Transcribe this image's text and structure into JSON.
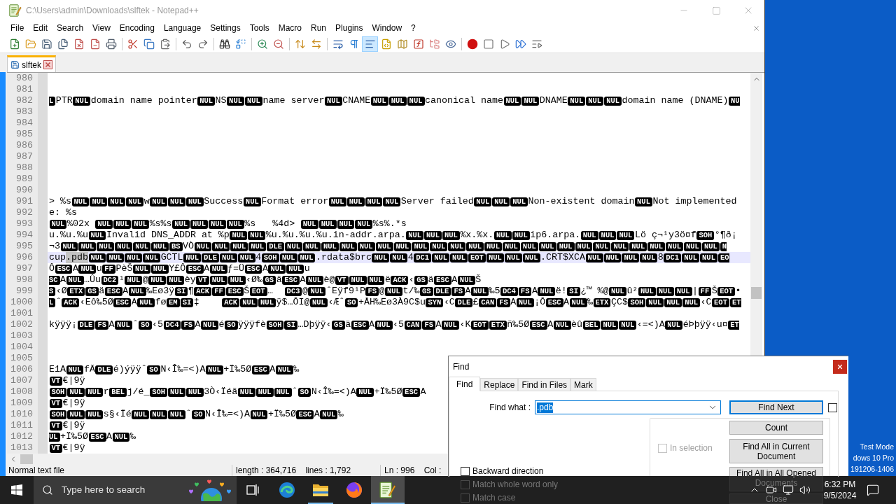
{
  "window": {
    "title": "C:\\Users\\admin\\Downloads\\slftek - Notepad++",
    "active": false
  },
  "menu": [
    "File",
    "Edit",
    "Search",
    "View",
    "Encoding",
    "Language",
    "Settings",
    "Tools",
    "Macro",
    "Run",
    "Plugins",
    "Window",
    "?"
  ],
  "toolbar": [
    [
      {
        "pressed": false
      },
      {
        "pressed": false
      },
      {
        "pressed": false
      },
      {
        "pressed": false
      },
      {
        "pressed": false
      },
      {
        "pressed": false
      },
      {
        "pressed": false
      }
    ],
    [
      {
        "pressed": false
      },
      {
        "pressed": false
      },
      {
        "pressed": false
      }
    ],
    [
      {
        "pressed": false
      },
      {
        "pressed": false
      }
    ],
    [
      {
        "pressed": false
      },
      {
        "pressed": false
      }
    ],
    [
      {
        "pressed": false
      },
      {
        "pressed": false
      }
    ],
    [
      {
        "pressed": false
      },
      {
        "pressed": false
      }
    ],
    [
      {
        "pressed": false
      },
      {
        "pressed": false
      },
      {
        "pressed": true
      },
      {
        "pressed": false
      },
      {
        "pressed": false
      },
      {
        "pressed": false
      },
      {
        "pressed": false
      },
      {
        "pressed": false
      }
    ],
    [
      {
        "pressed": false
      },
      {
        "pressed": false
      },
      {
        "pressed": false
      },
      {
        "pressed": false
      },
      {
        "pressed": false
      }
    ]
  ],
  "tabs": [
    {
      "label": "slftek",
      "selected": true,
      "modified": false
    }
  ],
  "editor": {
    "lines": [
      {
        "number": "980",
        "current": false
      },
      {
        "number": "981",
        "current": false
      },
      {
        "number": "982",
        "current": false,
        "segments": [
          {
            "kind": "ctrl_cut_left",
            "text": "L"
          },
          {
            "kind": "text",
            "text": "PTR"
          },
          {
            "kind": "ctrl",
            "text": "NUL"
          },
          {
            "kind": "text",
            "text": "domain name pointer"
          },
          {
            "kind": "ctrl",
            "text": "NUL"
          },
          {
            "kind": "text",
            "text": "NS"
          },
          {
            "kind": "ctrl",
            "text": "NUL"
          },
          {
            "kind": "ctrl",
            "text": "NUL"
          },
          {
            "kind": "text",
            "text": "name server"
          },
          {
            "kind": "ctrl",
            "text": "NUL"
          },
          {
            "kind": "text",
            "text": "CNAME"
          },
          {
            "kind": "ctrl",
            "text": "NUL"
          },
          {
            "kind": "ctrl",
            "text": "NUL"
          },
          {
            "kind": "ctrl",
            "text": "NUL"
          },
          {
            "kind": "text",
            "text": "canonical name"
          },
          {
            "kind": "ctrl",
            "text": "NUL"
          },
          {
            "kind": "ctrl",
            "text": "NUL"
          },
          {
            "kind": "text",
            "text": "DNAME"
          },
          {
            "kind": "ctrl",
            "text": "NUL"
          },
          {
            "kind": "ctrl",
            "text": "NUL"
          },
          {
            "kind": "ctrl",
            "text": "NUL"
          },
          {
            "kind": "text",
            "text": "domain name (DNAME)"
          },
          {
            "kind": "ctrl_cut_right",
            "text": "NU"
          }
        ]
      },
      {
        "number": "983",
        "current": false
      },
      {
        "number": "984",
        "current": false
      },
      {
        "number": "985",
        "current": false
      },
      {
        "number": "986",
        "current": false
      },
      {
        "number": "987",
        "current": false
      },
      {
        "number": "988",
        "current": false
      },
      {
        "number": "989",
        "current": false
      },
      {
        "number": "990",
        "current": false
      },
      {
        "number": "991",
        "current": false,
        "segments": [
          {
            "kind": "text",
            "text": "> %s"
          },
          {
            "kind": "ctrl",
            "text": "NUL"
          },
          {
            "kind": "ctrl",
            "text": "NUL"
          },
          {
            "kind": "ctrl",
            "text": "NUL"
          },
          {
            "kind": "ctrl",
            "text": "NUL"
          },
          {
            "kind": "text",
            "text": "w"
          },
          {
            "kind": "ctrl",
            "text": "NUL"
          },
          {
            "kind": "ctrl",
            "text": "NUL"
          },
          {
            "kind": "ctrl",
            "text": "NUL"
          },
          {
            "kind": "text",
            "text": "Success"
          },
          {
            "kind": "ctrl",
            "text": "NUL"
          },
          {
            "kind": "text",
            "text": "Format error"
          },
          {
            "kind": "ctrl",
            "text": "NUL"
          },
          {
            "kind": "ctrl",
            "text": "NUL"
          },
          {
            "kind": "ctrl",
            "text": "NUL"
          },
          {
            "kind": "ctrl",
            "text": "NUL"
          },
          {
            "kind": "text",
            "text": "Server failed"
          },
          {
            "kind": "ctrl",
            "text": "NUL"
          },
          {
            "kind": "ctrl",
            "text": "NUL"
          },
          {
            "kind": "ctrl",
            "text": "NUL"
          },
          {
            "kind": "text",
            "text": "Non-existent domain"
          },
          {
            "kind": "ctrl",
            "text": "NUL"
          },
          {
            "kind": "text",
            "text": "Not implemented"
          }
        ]
      },
      {
        "number": "992",
        "current": false,
        "segments": [
          {
            "kind": "text",
            "text": "e: %s"
          }
        ]
      },
      {
        "number": "993",
        "current": false,
        "segments": [
          {
            "kind": "ctrl",
            "text": "NUL"
          },
          {
            "kind": "text",
            "text": "%02x "
          },
          {
            "kind": "ctrl",
            "text": "NUL"
          },
          {
            "kind": "ctrl",
            "text": "NUL"
          },
          {
            "kind": "ctrl",
            "text": "NUL"
          },
          {
            "kind": "text",
            "text": "%s%s"
          },
          {
            "kind": "ctrl",
            "text": "NUL"
          },
          {
            "kind": "ctrl",
            "text": "NUL"
          },
          {
            "kind": "ctrl",
            "text": "NUL"
          },
          {
            "kind": "ctrl",
            "text": "NUL"
          },
          {
            "kind": "text",
            "text": "%s   %4d> "
          },
          {
            "kind": "ctrl",
            "text": "NUL"
          },
          {
            "kind": "ctrl",
            "text": "NUL"
          },
          {
            "kind": "ctrl",
            "text": "NUL"
          },
          {
            "kind": "ctrl",
            "text": "NUL"
          },
          {
            "kind": "text",
            "text": "%s%.*s"
          }
        ]
      },
      {
        "number": "994",
        "current": false,
        "segments": [
          {
            "kind": "text",
            "text": "u.%u.%u"
          },
          {
            "kind": "ctrl",
            "text": "NUL"
          },
          {
            "kind": "text",
            "text": "Invalid DNS_ADDR at %p"
          },
          {
            "kind": "ctrl",
            "text": "NUL"
          },
          {
            "kind": "ctrl",
            "text": "NUL"
          },
          {
            "kind": "text",
            "text": "%u.%u.%u.%u.in-addr.arpa."
          },
          {
            "kind": "ctrl",
            "text": "NUL"
          },
          {
            "kind": "ctrl",
            "text": "NUL"
          },
          {
            "kind": "ctrl",
            "text": "NUL"
          },
          {
            "kind": "text",
            "text": "%x.%x."
          },
          {
            "kind": "ctrl",
            "text": "NUL"
          },
          {
            "kind": "ctrl",
            "text": "NUL"
          },
          {
            "kind": "text",
            "text": "ip6.arpa."
          },
          {
            "kind": "ctrl",
            "text": "NUL"
          },
          {
            "kind": "ctrl",
            "text": "NUL"
          },
          {
            "kind": "ctrl",
            "text": "NUL"
          },
          {
            "kind": "text",
            "text": "Lö ç¬¹y3ö¤f"
          },
          {
            "kind": "ctrl",
            "text": "SOH"
          },
          {
            "kind": "text",
            "text": "°¶ð¡"
          }
        ]
      },
      {
        "number": "995",
        "current": false,
        "segments": [
          {
            "kind": "text",
            "text": "¬3"
          },
          {
            "kind": "ctrl",
            "text": "NUL"
          },
          {
            "kind": "ctrl",
            "text": "NUL"
          },
          {
            "kind": "ctrl",
            "text": "NUL"
          },
          {
            "kind": "ctrl",
            "text": "NUL"
          },
          {
            "kind": "ctrl",
            "text": "NUL"
          },
          {
            "kind": "ctrl",
            "text": "NUL"
          },
          {
            "kind": "ctrl",
            "text": "BS"
          },
          {
            "kind": "text",
            "text": "VÒ"
          },
          {
            "kind": "ctrl",
            "text": "NUL"
          },
          {
            "kind": "ctrl",
            "text": "NUL"
          },
          {
            "kind": "ctrl",
            "text": "NUL"
          },
          {
            "kind": "ctrl",
            "text": "NUL"
          },
          {
            "kind": "ctrl",
            "text": "DLE"
          },
          {
            "kind": "ctrl",
            "text": "NUL"
          },
          {
            "kind": "ctrl",
            "text": "NUL"
          },
          {
            "kind": "ctrl",
            "text": "NUL"
          },
          {
            "kind": "ctrl",
            "text": "NUL"
          },
          {
            "kind": "ctrl",
            "text": "NUL"
          },
          {
            "kind": "ctrl",
            "text": "NUL"
          },
          {
            "kind": "ctrl",
            "text": "NUL"
          },
          {
            "kind": "ctrl",
            "text": "NUL"
          },
          {
            "kind": "ctrl",
            "text": "NUL"
          },
          {
            "kind": "ctrl",
            "text": "NUL"
          },
          {
            "kind": "ctrl",
            "text": "NUL"
          },
          {
            "kind": "ctrl",
            "text": "NUL"
          },
          {
            "kind": "ctrl",
            "text": "NUL"
          },
          {
            "kind": "ctrl",
            "text": "NUL"
          },
          {
            "kind": "ctrl",
            "text": "NUL"
          },
          {
            "kind": "ctrl",
            "text": "NUL"
          },
          {
            "kind": "ctrl",
            "text": "NUL"
          },
          {
            "kind": "ctrl",
            "text": "NUL"
          },
          {
            "kind": "ctrl",
            "text": "NUL"
          },
          {
            "kind": "ctrl",
            "text": "NUL"
          },
          {
            "kind": "ctrl",
            "text": "NUL"
          },
          {
            "kind": "ctrl",
            "text": "NUL"
          },
          {
            "kind": "ctrl",
            "text": "NUL"
          },
          {
            "kind": "ctrl",
            "text": "NUL"
          },
          {
            "kind": "ctrl_cut_right",
            "text": "N"
          }
        ]
      },
      {
        "number": "996",
        "current": true,
        "segments": [
          {
            "kind": "text",
            "text": "cup"
          },
          {
            "kind": "selection",
            "text": ".pdb"
          },
          {
            "kind": "ctrl",
            "text": "NUL"
          },
          {
            "kind": "ctrl",
            "text": "NUL"
          },
          {
            "kind": "ctrl",
            "text": "NUL"
          },
          {
            "kind": "ctrl",
            "text": "NUL"
          },
          {
            "kind": "text",
            "text": "GCTL"
          },
          {
            "kind": "ctrl",
            "text": "NUL"
          },
          {
            "kind": "ctrl",
            "text": "DLE"
          },
          {
            "kind": "ctrl",
            "text": "NUL"
          },
          {
            "kind": "ctrl",
            "text": "NUL"
          },
          {
            "kind": "text",
            "text": "4"
          },
          {
            "kind": "ctrl",
            "text": "SOH"
          },
          {
            "kind": "ctrl",
            "text": "NUL"
          },
          {
            "kind": "ctrl",
            "text": "NUL"
          },
          {
            "kind": "text",
            "text": ".rdata$brc"
          },
          {
            "kind": "ctrl",
            "text": "NUL"
          },
          {
            "kind": "ctrl",
            "text": "NUL"
          },
          {
            "kind": "text",
            "text": "4"
          },
          {
            "kind": "ctrl",
            "text": "DC1"
          },
          {
            "kind": "ctrl",
            "text": "NUL"
          },
          {
            "kind": "ctrl",
            "text": "NUL"
          },
          {
            "kind": "ctrl",
            "text": "EOT"
          },
          {
            "kind": "ctrl",
            "text": "NUL"
          },
          {
            "kind": "ctrl",
            "text": "NUL"
          },
          {
            "kind": "ctrl",
            "text": "NUL"
          },
          {
            "kind": "text",
            "text": ".CRT$XCA"
          },
          {
            "kind": "ctrl",
            "text": "NUL"
          },
          {
            "kind": "ctrl",
            "text": "NUL"
          },
          {
            "kind": "ctrl",
            "text": "NUL"
          },
          {
            "kind": "ctrl",
            "text": "NUL"
          },
          {
            "kind": "text",
            "text": "8"
          },
          {
            "kind": "ctrl",
            "text": "DC1"
          },
          {
            "kind": "ctrl",
            "text": "NUL"
          },
          {
            "kind": "ctrl",
            "text": "NUL"
          },
          {
            "kind": "ctrl_cut_right",
            "text": "EO"
          }
        ]
      },
      {
        "number": "997",
        "current": false,
        "segments": [
          {
            "kind": "text",
            "text": "Ô"
          },
          {
            "kind": "ctrl",
            "text": "ESC"
          },
          {
            "kind": "text",
            "text": "A"
          },
          {
            "kind": "ctrl",
            "text": "NUL"
          },
          {
            "kind": "text",
            "text": "u"
          },
          {
            "kind": "ctrl",
            "text": "FF"
          },
          {
            "kind": "text",
            "text": "PèŠ"
          },
          {
            "kind": "ctrl",
            "text": "NUL"
          },
          {
            "kind": "ctrl",
            "text": "NUL"
          },
          {
            "kind": "text",
            "text": "Y£Ô"
          },
          {
            "kind": "ctrl",
            "text": "ESC"
          },
          {
            "kind": "text",
            "text": "A"
          },
          {
            "kind": "ctrl",
            "text": "NUL"
          },
          {
            "kind": "text",
            "text": "ƒ=Ü"
          },
          {
            "kind": "ctrl",
            "text": "ESC"
          },
          {
            "kind": "text",
            "text": "A"
          },
          {
            "kind": "ctrl",
            "text": "NUL"
          },
          {
            "kind": "ctrl",
            "text": "NUL"
          },
          {
            "kind": "text",
            "text": "u"
          }
        ]
      },
      {
        "number": "998",
        "current": false,
        "segments": [
          {
            "kind": "ctrl_cut_left",
            "text": "SC"
          },
          {
            "kind": "text",
            "text": "A"
          },
          {
            "kind": "ctrl",
            "text": "NUL"
          },
          {
            "kind": "text",
            "text": "…Ûu"
          },
          {
            "kind": "ctrl",
            "text": "DC2"
          },
          {
            "kind": "text",
            "text": "¹"
          },
          {
            "kind": "ctrl",
            "text": "NUL"
          },
          {
            "kind": "text",
            "text": "@"
          },
          {
            "kind": "ctrl",
            "text": "NUL"
          },
          {
            "kind": "ctrl",
            "text": "NUL"
          },
          {
            "kind": "text",
            "text": "èy"
          },
          {
            "kind": "ctrl",
            "text": "VT"
          },
          {
            "kind": "ctrl",
            "text": "NUL"
          },
          {
            "kind": "ctrl",
            "text": "NUL"
          },
          {
            "kind": "text",
            "text": "‹Ø‰"
          },
          {
            "kind": "ctrl",
            "text": "GS"
          },
          {
            "kind": "text",
            "text": "ä"
          },
          {
            "kind": "ctrl",
            "text": "ESC"
          },
          {
            "kind": "text",
            "text": "A"
          },
          {
            "kind": "ctrl",
            "text": "NUL"
          },
          {
            "kind": "text",
            "text": "è@"
          },
          {
            "kind": "ctrl",
            "text": "VT"
          },
          {
            "kind": "ctrl",
            "text": "NUL"
          },
          {
            "kind": "ctrl",
            "text": "NUL"
          },
          {
            "kind": "text",
            "text": "ë"
          },
          {
            "kind": "ctrl",
            "text": "ACK"
          },
          {
            "kind": "text",
            "text": "‹"
          },
          {
            "kind": "ctrl",
            "text": "GS"
          },
          {
            "kind": "text",
            "text": "ä"
          },
          {
            "kind": "ctrl",
            "text": "ESC"
          },
          {
            "kind": "text",
            "text": "A"
          },
          {
            "kind": "ctrl",
            "text": "NUL"
          },
          {
            "kind": "text",
            "text": "Š"
          }
        ]
      },
      {
        "number": "999",
        "current": false,
        "segments": [
          {
            "kind": "ctrl_cut_left",
            "text": "S"
          },
          {
            "kind": "text",
            "text": "‹Ø"
          },
          {
            "kind": "ctrl",
            "text": "ETX"
          },
          {
            "kind": "ctrl",
            "text": "GS"
          },
          {
            "kind": "text",
            "text": "ä"
          },
          {
            "kind": "ctrl",
            "text": "ESC"
          },
          {
            "kind": "text",
            "text": "A"
          },
          {
            "kind": "ctrl",
            "text": "NUL"
          },
          {
            "kind": "text",
            "text": "‰Eø3ÿ"
          },
          {
            "kind": "ctrl",
            "text": "SI"
          },
          {
            "kind": "text",
            "text": "¶"
          },
          {
            "kind": "ctrl",
            "text": "ACK"
          },
          {
            "kind": "ctrl",
            "text": "FF"
          },
          {
            "kind": "ctrl",
            "text": "ESC"
          },
          {
            "kind": "text",
            "text": "Š"
          },
          {
            "kind": "ctrl",
            "text": "EOT"
          },
          {
            "kind": "text",
            "text": "…  "
          },
          {
            "kind": "ctrl",
            "text": "DC3"
          },
          {
            "kind": "text",
            "text": "@"
          },
          {
            "kind": "ctrl",
            "text": "NUL"
          },
          {
            "kind": "text",
            "text": "ˆEÿf9¹P"
          },
          {
            "kind": "ctrl",
            "text": "FS"
          },
          {
            "kind": "text",
            "text": "@"
          },
          {
            "kind": "ctrl",
            "text": "NUL"
          },
          {
            "kind": "text",
            "text": "t/‰"
          },
          {
            "kind": "ctrl",
            "text": "GS"
          },
          {
            "kind": "ctrl",
            "text": "DLE"
          },
          {
            "kind": "ctrl",
            "text": "FS"
          },
          {
            "kind": "text",
            "text": "A"
          },
          {
            "kind": "ctrl",
            "text": "NUL"
          },
          {
            "kind": "text",
            "text": "‰5"
          },
          {
            "kind": "ctrl",
            "text": "DC4"
          },
          {
            "kind": "ctrl",
            "text": "FS"
          },
          {
            "kind": "text",
            "text": "A"
          },
          {
            "kind": "ctrl",
            "text": "NUL"
          },
          {
            "kind": "text",
            "text": "ë!"
          },
          {
            "kind": "ctrl",
            "text": "SI"
          },
          {
            "kind": "text",
            "text": "¿™ %@"
          },
          {
            "kind": "ctrl",
            "text": "NUL"
          },
          {
            "kind": "text",
            "text": "û²"
          },
          {
            "kind": "ctrl",
            "text": "NUL"
          },
          {
            "kind": "ctrl",
            "text": "NUL"
          },
          {
            "kind": "ctrl",
            "text": "NUL"
          },
          {
            "kind": "text",
            "text": "|"
          },
          {
            "kind": "ctrl",
            "text": "FF"
          },
          {
            "kind": "text",
            "text": "Š"
          },
          {
            "kind": "ctrl",
            "text": "EOT"
          },
          {
            "kind": "text",
            "text": "•"
          }
        ]
      },
      {
        "number": "1000",
        "current": false,
        "segments": [
          {
            "kind": "ctrl_cut_left",
            "text": "L"
          },
          {
            "kind": "text",
            "text": "ˆ"
          },
          {
            "kind": "ctrl",
            "text": "ACK"
          },
          {
            "kind": "text",
            "text": "‹Eô‰5Ø"
          },
          {
            "kind": "ctrl",
            "text": "ESC"
          },
          {
            "kind": "text",
            "text": "A"
          },
          {
            "kind": "ctrl",
            "text": "NUL"
          },
          {
            "kind": "text",
            "text": "fø"
          },
          {
            "kind": "ctrl",
            "text": "EM"
          },
          {
            "kind": "ctrl",
            "text": "SI"
          },
          {
            "kind": "text",
            "text": "‡    "
          },
          {
            "kind": "ctrl",
            "text": "ACK"
          },
          {
            "kind": "ctrl",
            "text": "NUL"
          },
          {
            "kind": "ctrl",
            "text": "NUL"
          },
          {
            "kind": "text",
            "text": "ÿ$…ÔI@"
          },
          {
            "kind": "ctrl",
            "text": "NUL"
          },
          {
            "kind": "text",
            "text": "‹Æˆ"
          },
          {
            "kind": "ctrl",
            "text": "SO"
          },
          {
            "kind": "text",
            "text": "+ÅH‰Eø3À9C$u"
          },
          {
            "kind": "ctrl",
            "text": "SYN"
          },
          {
            "kind": "text",
            "text": "‹C"
          },
          {
            "kind": "ctrl",
            "text": "DLE"
          },
          {
            "kind": "text",
            "text": "£"
          },
          {
            "kind": "ctrl",
            "text": "CAN"
          },
          {
            "kind": "ctrl",
            "text": "FS"
          },
          {
            "kind": "text",
            "text": "A"
          },
          {
            "kind": "ctrl",
            "text": "NUL"
          },
          {
            "kind": "text",
            "text": "¡Ô"
          },
          {
            "kind": "ctrl",
            "text": "ESC"
          },
          {
            "kind": "text",
            "text": "A"
          },
          {
            "kind": "ctrl",
            "text": "NUL"
          },
          {
            "kind": "text",
            "text": "‰"
          },
          {
            "kind": "ctrl",
            "text": "ETX"
          },
          {
            "kind": "text",
            "text": "ÇC$"
          },
          {
            "kind": "ctrl",
            "text": "SOH"
          },
          {
            "kind": "ctrl",
            "text": "NUL"
          },
          {
            "kind": "ctrl",
            "text": "NUL"
          },
          {
            "kind": "ctrl",
            "text": "NUL"
          },
          {
            "kind": "text",
            "text": "‹C"
          },
          {
            "kind": "ctrl",
            "text": "EOT"
          },
          {
            "kind": "ctrl_cut_right",
            "text": "ET"
          }
        ]
      },
      {
        "number": "1001",
        "current": false
      },
      {
        "number": "1002",
        "current": false,
        "segments": [
          {
            "kind": "text",
            "text": "kÿÿÿ¡"
          },
          {
            "kind": "ctrl",
            "text": "DLE"
          },
          {
            "kind": "ctrl",
            "text": "FS"
          },
          {
            "kind": "text",
            "text": "A"
          },
          {
            "kind": "ctrl",
            "text": "NUL"
          },
          {
            "kind": "text",
            "text": "ˆ"
          },
          {
            "kind": "ctrl",
            "text": "SO"
          },
          {
            "kind": "text",
            "text": "‹5"
          },
          {
            "kind": "ctrl",
            "text": "DC4"
          },
          {
            "kind": "ctrl",
            "text": "FS"
          },
          {
            "kind": "text",
            "text": "A"
          },
          {
            "kind": "ctrl",
            "text": "NUL"
          },
          {
            "kind": "text",
            "text": "é"
          },
          {
            "kind": "ctrl",
            "text": "SO"
          },
          {
            "kind": "text",
            "text": "ÿÿÿfè"
          },
          {
            "kind": "ctrl",
            "text": "SOH"
          },
          {
            "kind": "ctrl",
            "text": "SI"
          },
          {
            "kind": "text",
            "text": "…Dþÿÿ‹"
          },
          {
            "kind": "ctrl",
            "text": "GS"
          },
          {
            "kind": "text",
            "text": "ä"
          },
          {
            "kind": "ctrl",
            "text": "ESC"
          },
          {
            "kind": "text",
            "text": "A"
          },
          {
            "kind": "ctrl",
            "text": "NUL"
          },
          {
            "kind": "text",
            "text": "‹5"
          },
          {
            "kind": "ctrl",
            "text": "CAN"
          },
          {
            "kind": "ctrl",
            "text": "FS"
          },
          {
            "kind": "text",
            "text": "A"
          },
          {
            "kind": "ctrl",
            "text": "NUL"
          },
          {
            "kind": "text",
            "text": "‹K"
          },
          {
            "kind": "ctrl",
            "text": "EOT"
          },
          {
            "kind": "ctrl",
            "text": "ETX"
          },
          {
            "kind": "text",
            "text": "ñ‰5Ø"
          },
          {
            "kind": "ctrl",
            "text": "ESC"
          },
          {
            "kind": "text",
            "text": "A"
          },
          {
            "kind": "ctrl",
            "text": "NUL"
          },
          {
            "kind": "text",
            "text": "èû"
          },
          {
            "kind": "ctrl",
            "text": "BEL"
          },
          {
            "kind": "ctrl",
            "text": "NUL"
          },
          {
            "kind": "ctrl",
            "text": "NUL"
          },
          {
            "kind": "text",
            "text": "‹=<)A"
          },
          {
            "kind": "ctrl",
            "text": "NUL"
          },
          {
            "kind": "text",
            "text": "éÞþÿÿ‹u¤"
          },
          {
            "kind": "ctrl_cut_right",
            "text": "ET"
          }
        ]
      },
      {
        "number": "1003",
        "current": false
      },
      {
        "number": "1004",
        "current": false
      },
      {
        "number": "1005",
        "current": false
      },
      {
        "number": "1006",
        "current": false,
        "segments": [
          {
            "kind": "text",
            "text": "E1A"
          },
          {
            "kind": "ctrl",
            "text": "NUL"
          },
          {
            "kind": "text",
            "text": "fÄ"
          },
          {
            "kind": "ctrl",
            "text": "DLE"
          },
          {
            "kind": "text",
            "text": "é)ýÿÿˆ"
          },
          {
            "kind": "ctrl",
            "text": "SO"
          },
          {
            "kind": "text",
            "text": "N‹Î‰=<)A"
          },
          {
            "kind": "ctrl",
            "text": "NUL"
          },
          {
            "kind": "text",
            "text": "+Ï‰5Ø"
          },
          {
            "kind": "ctrl",
            "text": "ESC"
          },
          {
            "kind": "text",
            "text": "A"
          },
          {
            "kind": "ctrl",
            "text": "NUL"
          },
          {
            "kind": "text",
            "text": "‰"
          }
        ]
      },
      {
        "number": "1007",
        "current": false,
        "segments": [
          {
            "kind": "ctrl",
            "text": "VT"
          },
          {
            "kind": "text",
            "text": "€|9ÿ"
          }
        ]
      },
      {
        "number": "1008",
        "current": false,
        "segments": [
          {
            "kind": "ctrl",
            "text": "SOH"
          },
          {
            "kind": "ctrl",
            "text": "NUL"
          },
          {
            "kind": "ctrl",
            "text": "NUL"
          },
          {
            "kind": "text",
            "text": "r"
          },
          {
            "kind": "ctrl",
            "text": "BEL"
          },
          {
            "kind": "text",
            "text": "j/é_"
          },
          {
            "kind": "ctrl",
            "text": "SOH"
          },
          {
            "kind": "ctrl",
            "text": "NUL"
          },
          {
            "kind": "ctrl",
            "text": "NUL"
          },
          {
            "kind": "text",
            "text": "3Ò‹Ïéã"
          },
          {
            "kind": "ctrl",
            "text": "NUL"
          },
          {
            "kind": "ctrl",
            "text": "NUL"
          },
          {
            "kind": "ctrl",
            "text": "NUL"
          },
          {
            "kind": "text",
            "text": "ˆ"
          },
          {
            "kind": "ctrl",
            "text": "SO"
          },
          {
            "kind": "text",
            "text": "N‹Î‰=<)A"
          },
          {
            "kind": "ctrl",
            "text": "NUL"
          },
          {
            "kind": "text",
            "text": "+Ï‰5Ø"
          },
          {
            "kind": "ctrl",
            "text": "ESC"
          },
          {
            "kind": "text",
            "text": "A"
          }
        ]
      },
      {
        "number": "1009",
        "current": false,
        "segments": [
          {
            "kind": "ctrl",
            "text": "VT"
          },
          {
            "kind": "text",
            "text": "€|9ÿ"
          }
        ]
      },
      {
        "number": "1010",
        "current": false,
        "segments": [
          {
            "kind": "ctrl",
            "text": "SOH"
          },
          {
            "kind": "ctrl",
            "text": "NUL"
          },
          {
            "kind": "ctrl",
            "text": "NUL"
          },
          {
            "kind": "text",
            "text": "s§‹Ïé"
          },
          {
            "kind": "ctrl",
            "text": "NUL"
          },
          {
            "kind": "ctrl",
            "text": "NUL"
          },
          {
            "kind": "ctrl",
            "text": "NUL"
          },
          {
            "kind": "text",
            "text": "ˆ"
          },
          {
            "kind": "ctrl",
            "text": "SO"
          },
          {
            "kind": "text",
            "text": "N‹Î‰=<)A"
          },
          {
            "kind": "ctrl",
            "text": "NUL"
          },
          {
            "kind": "text",
            "text": "+Ï‰5Ø"
          },
          {
            "kind": "ctrl",
            "text": "ESC"
          },
          {
            "kind": "text",
            "text": "A"
          },
          {
            "kind": "ctrl",
            "text": "NUL"
          },
          {
            "kind": "text",
            "text": "‰"
          }
        ]
      },
      {
        "number": "1011",
        "current": false,
        "segments": [
          {
            "kind": "ctrl",
            "text": "VT"
          },
          {
            "kind": "text",
            "text": "€|9ÿ"
          }
        ]
      },
      {
        "number": "1012",
        "current": false,
        "segments": [
          {
            "kind": "ctrl_cut_left",
            "text": "UL"
          },
          {
            "kind": "text",
            "text": "+Ï‰5Ø"
          },
          {
            "kind": "ctrl",
            "text": "ESC"
          },
          {
            "kind": "text",
            "text": "A"
          },
          {
            "kind": "ctrl",
            "text": "NUL"
          },
          {
            "kind": "text",
            "text": "‰"
          }
        ]
      },
      {
        "number": "1013",
        "current": false,
        "segments": [
          {
            "kind": "ctrl",
            "text": "VT"
          },
          {
            "kind": "text",
            "text": "€|9ÿ"
          }
        ]
      }
    ]
  },
  "status_bar": {
    "file_type": "Normal text file",
    "length": "length : 364,716    lines : 1,792",
    "position": "Ln : 996    Col :"
  },
  "desktop_text": [
    "Test Mode",
    "dows 10 Pro",
    "191206-1406"
  ],
  "find_dialog": {
    "title": "Find",
    "tabs": [
      {
        "label": "Find",
        "selected": true
      },
      {
        "label": "Replace",
        "selected": false
      },
      {
        "label": "Find in Files",
        "selected": false
      },
      {
        "label": "Mark",
        "selected": false
      }
    ],
    "find_what": {
      "label": "Find what :",
      "value": ".pdb",
      "value_selected": true
    },
    "transparency_checkbox": {
      "checked": false
    },
    "buttons": [
      {
        "label": "Find Next",
        "default": true
      },
      {
        "label": "Count",
        "default": false
      },
      {
        "label": "Find All in Current Document",
        "default": false
      },
      {
        "label": "Find All in All Opened Documents",
        "default": false
      },
      {
        "label": "Close",
        "default": false
      }
    ],
    "in_selection": {
      "label": "In selection",
      "checked": false,
      "disabled": true
    },
    "options": [
      {
        "label": "Backward direction",
        "checked": false
      },
      {
        "label": "Match whole word only",
        "checked": false
      },
      {
        "label": "Match case",
        "checked": false
      }
    ]
  },
  "taskbar": {
    "search_placeholder": "Type here to search",
    "apps": [
      {
        "running": false,
        "active": false
      },
      {
        "running": true,
        "active": false
      },
      {
        "running": false,
        "active": false
      },
      {
        "running": true,
        "active": true
      }
    ],
    "time": "6:32 PM",
    "date": "9/5/2024"
  }
}
